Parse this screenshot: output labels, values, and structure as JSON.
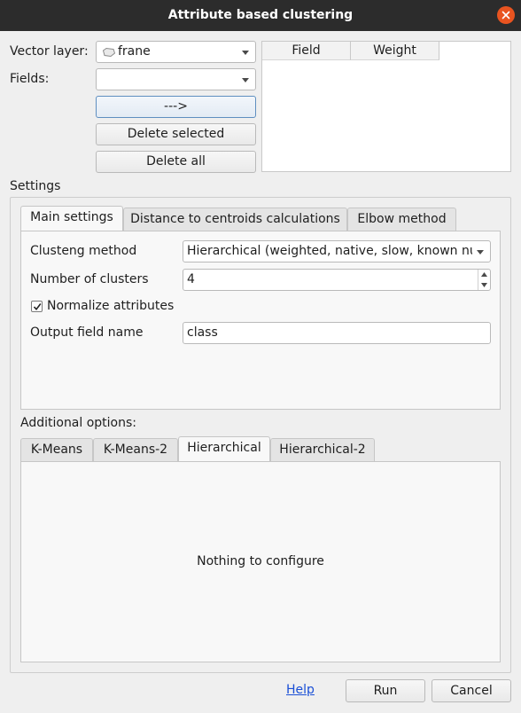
{
  "window": {
    "title": "Attribute based clustering"
  },
  "vector_layer": {
    "label": "Vector layer:",
    "value": "frane"
  },
  "fields": {
    "label": "Fields:",
    "value": ""
  },
  "buttons": {
    "add": "--->",
    "delete_selected": "Delete selected",
    "delete_all": "Delete all"
  },
  "table": {
    "columns": [
      "Field",
      "Weight"
    ]
  },
  "settings": {
    "label": "Settings",
    "tabs": [
      "Main settings",
      "Distance to centroids calculations",
      "Elbow method"
    ],
    "clustering_method_label": "Clusteng method",
    "clustering_method_value": "Hierarchical (weighted, native, slow, known number of clusters)",
    "num_clusters_label": "Number of clusters",
    "num_clusters_value": "4",
    "normalize_label": "Normalize attributes",
    "normalize_checked": true,
    "output_field_label": "Output field name",
    "output_field_value": "class"
  },
  "additional": {
    "label": "Additional options:",
    "tabs": [
      "K-Means",
      "K-Means-2",
      "Hierarchical",
      "Hierarchical-2"
    ],
    "active_tab": "Hierarchical",
    "message": "Nothing to configure"
  },
  "footer": {
    "help": "Help",
    "run": "Run",
    "cancel": "Cancel"
  }
}
